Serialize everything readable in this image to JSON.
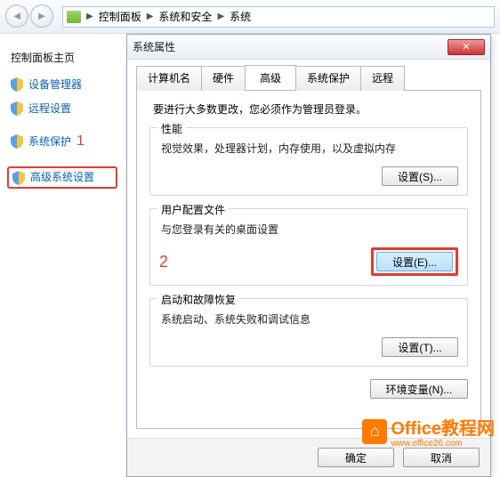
{
  "breadcrumb": {
    "root_icon": "computer",
    "items": [
      "控制面板",
      "系统和安全",
      "系统"
    ]
  },
  "sidebar": {
    "title": "控制面板主页",
    "items": [
      {
        "label": "设备管理器"
      },
      {
        "label": "远程设置"
      },
      {
        "label": "系统保护"
      },
      {
        "label": "高级系统设置"
      }
    ],
    "annotation1": "1"
  },
  "dialog": {
    "title": "系统属性",
    "tabs": [
      {
        "label": "计算机名"
      },
      {
        "label": "硬件"
      },
      {
        "label": "高级",
        "active": true
      },
      {
        "label": "系统保护"
      },
      {
        "label": "远程"
      }
    ],
    "notice": "要进行大多数更改，您必须作为管理员登录。",
    "group1": {
      "title": "性能",
      "desc": "视觉效果，处理器计划，内存使用，以及虚拟内存",
      "btn": "设置(S)..."
    },
    "group2": {
      "title": "用户配置文件",
      "desc": "与您登录有关的桌面设置",
      "btn": "设置(E)..."
    },
    "group3": {
      "title": "启动和故障恢复",
      "desc": "系统启动、系统失败和调试信息",
      "btn": "设置(T)..."
    },
    "env_btn": "环境变量(N)...",
    "ok": "确定",
    "cancel": "取消",
    "annotation2": "2"
  },
  "watermark": {
    "name": "Office教程网",
    "url": "www.office26.com"
  }
}
